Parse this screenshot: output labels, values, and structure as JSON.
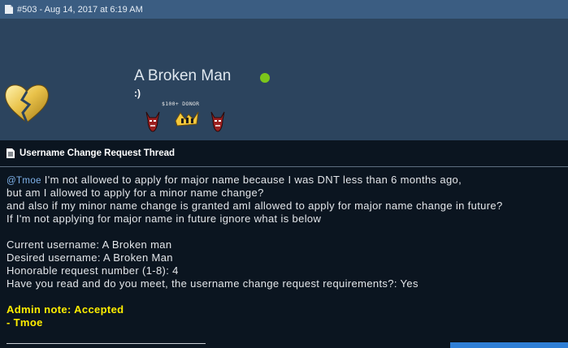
{
  "post": {
    "meta": "#503 - Aug 14, 2017 at 6:19 AM"
  },
  "user": {
    "name": "A Broken Man",
    "status_text": ":)",
    "online_color": "#7cc61b",
    "avatar_icon": "broken-heart-icon",
    "donor_label": "$100+ DONOR",
    "badges": [
      "demon-badge-icon",
      "gold-badge-icon",
      "demon-badge-icon"
    ]
  },
  "thread": {
    "title": "Username Change Request Thread",
    "icon": "document-icon"
  },
  "message": {
    "mention": "@Tmoe",
    "line1_rest": " I'm not allowed to apply for major name because I was DNT less than 6 months ago,",
    "line2": "but am I allowed to apply for a minor name change?",
    "line3": "and also if my minor name change is granted amI allowed to apply for major name change in future?",
    "line4": "If I'm not applying for major name in future ignore what is below",
    "current": "Current username: A Broken man",
    "desired": "Desired username: A Broken Man",
    "honorable": "Honorable request number (1-8): 4",
    "requirements": "Have you read and do you meet, the username change request requirements?: Yes",
    "admin_note": "Admin note: Accepted",
    "admin_sign": "- Tmoe"
  },
  "colors": {
    "header_bar": "#3b5d82",
    "user_panel": "#2c445e",
    "content_bg": "#0b1520",
    "admin_text": "#ffee00",
    "mention": "#7fb2ea"
  }
}
